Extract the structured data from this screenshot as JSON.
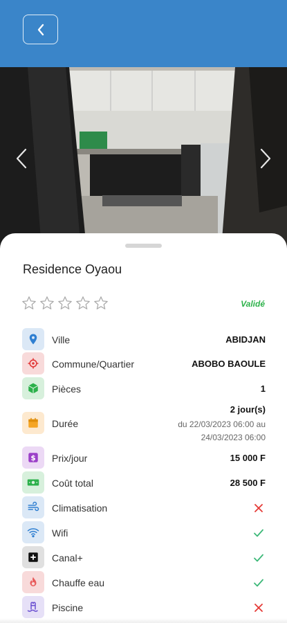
{
  "listing": {
    "title": "Residence Oyaou",
    "status": "Validé",
    "rating": 0,
    "rating_max": 5
  },
  "details": {
    "ville": {
      "label": "Ville",
      "value": "ABIDJAN"
    },
    "commune": {
      "label": "Commune/Quartier",
      "value": "ABOBO BAOULE"
    },
    "pieces": {
      "label": "Pièces",
      "value": "1"
    },
    "duree": {
      "label": "Durée",
      "value": "2 jour(s)",
      "range_line1": "du 22/03/2023 06:00 au",
      "range_line2": "24/03/2023 06:00"
    },
    "prix": {
      "label": "Prix/jour",
      "value": "15 000 F"
    },
    "cout": {
      "label": "Coût total",
      "value": "28 500 F"
    }
  },
  "amenities": {
    "climatisation": {
      "label": "Climatisation",
      "available": false
    },
    "wifi": {
      "label": "Wifi",
      "available": true
    },
    "canal": {
      "label": "Canal+",
      "available": true
    },
    "chauffe_eau": {
      "label": "Chauffe eau",
      "available": true
    },
    "piscine": {
      "label": "Piscine",
      "available": false
    }
  },
  "colors": {
    "header": "#3a85c9",
    "valid": "#2db24a",
    "check": "#3cb878",
    "cross": "#e53935"
  },
  "icons": [
    "back-arrow-icon",
    "chevron-left-icon",
    "chevron-right-icon",
    "star-icon",
    "location-pin-icon",
    "target-icon",
    "cube-icon",
    "calendar-icon",
    "dollar-icon",
    "banknote-icon",
    "wind-icon",
    "wifi-icon",
    "tv-plus-icon",
    "flame-icon",
    "pool-icon",
    "check-icon",
    "cross-icon"
  ]
}
